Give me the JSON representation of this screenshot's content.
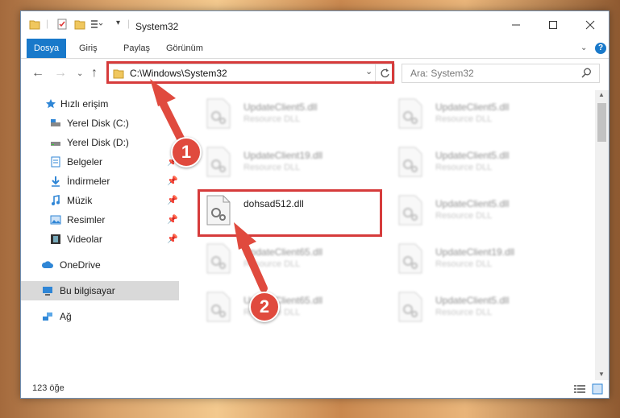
{
  "window": {
    "title": "System32"
  },
  "ribbon": {
    "tabs": [
      "Dosya",
      "Giriş",
      "Paylaş",
      "Görünüm"
    ]
  },
  "nav": {
    "address": "C:\\Windows\\System32",
    "search_placeholder": "Ara: System32"
  },
  "sidebar": {
    "items": [
      {
        "label": "Hızlı erişim"
      },
      {
        "label": "Yerel Disk (C:)"
      },
      {
        "label": "Yerel Disk (D:)"
      },
      {
        "label": "Belgeler"
      },
      {
        "label": "İndirmeler"
      },
      {
        "label": "Müzik"
      },
      {
        "label": "Resimler"
      },
      {
        "label": "Videolar"
      },
      {
        "label": "OneDrive"
      },
      {
        "label": "Bu bilgisayar"
      },
      {
        "label": "Ağ"
      }
    ]
  },
  "files": [
    {
      "name": "UpdateClient5.dll",
      "type": "Resource DLL"
    },
    {
      "name": "UpdateClient5.dll",
      "type": "Resource DLL"
    },
    {
      "name": "UpdateClient19.dll",
      "type": "Resource DLL"
    },
    {
      "name": "UpdateClient5.dll",
      "type": "Resource DLL"
    },
    {
      "name": "dohsad512.dll",
      "type": ""
    },
    {
      "name": "UpdateClient5.dll",
      "type": "Resource DLL"
    },
    {
      "name": "UpdateClient65.dll",
      "type": "Resource DLL"
    },
    {
      "name": "UpdateClient19.dll",
      "type": "Resource DLL"
    },
    {
      "name": "UpdateClient65.dll",
      "type": "Resource DLL"
    },
    {
      "name": "UpdateClient5.dll",
      "type": "Resource DLL"
    }
  ],
  "status": {
    "count": "123 öğe"
  },
  "annotations": {
    "step1": "1",
    "step2": "2"
  },
  "colors": {
    "accent": "#1979ca",
    "annotation": "#e04a3e"
  }
}
